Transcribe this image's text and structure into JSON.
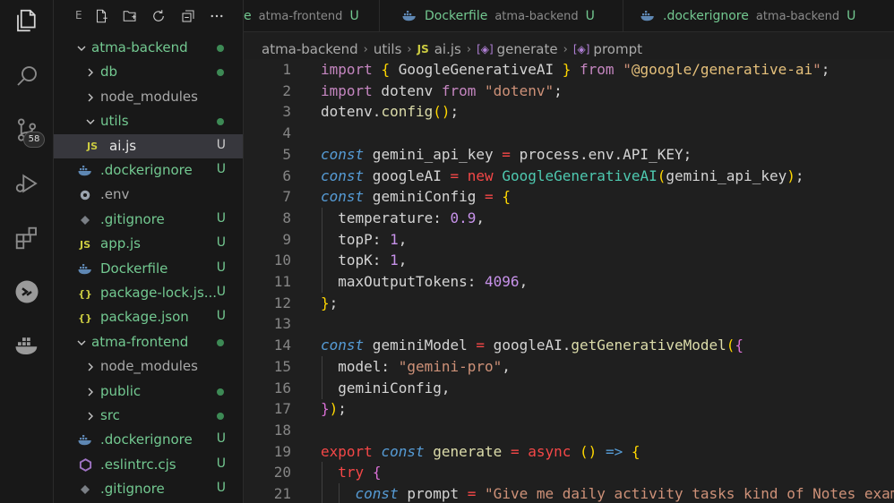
{
  "activity_bar": {
    "items": [
      {
        "name": "explorer-icon"
      },
      {
        "name": "search-icon"
      },
      {
        "name": "source-control-icon",
        "badge": "58"
      },
      {
        "name": "run-debug-icon"
      },
      {
        "name": "extensions-icon"
      },
      {
        "name": "remote-icon"
      },
      {
        "name": "docker-icon"
      }
    ]
  },
  "sidebar": {
    "toolbar_letter": "E",
    "tree": [
      {
        "label": "atma-backend",
        "type": "folder",
        "open": true,
        "level": 0,
        "status": "dot"
      },
      {
        "label": "db",
        "type": "folder",
        "open": false,
        "level": 1,
        "status": "dot"
      },
      {
        "label": "node_modules",
        "type": "folder",
        "open": false,
        "level": 1,
        "status": ""
      },
      {
        "label": "utils",
        "type": "folder",
        "open": true,
        "level": 1,
        "status": "dot"
      },
      {
        "label": "ai.js",
        "type": "js",
        "level": 2,
        "status": "U",
        "selected": true
      },
      {
        "label": ".dockerignore",
        "type": "docker",
        "level": 1,
        "status": "U"
      },
      {
        "label": ".env",
        "type": "gear",
        "level": 1,
        "status": ""
      },
      {
        "label": ".gitignore",
        "type": "git",
        "level": 1,
        "status": "U"
      },
      {
        "label": "app.js",
        "type": "js",
        "level": 1,
        "status": "U"
      },
      {
        "label": "Dockerfile",
        "type": "docker",
        "level": 1,
        "status": "U"
      },
      {
        "label": "package-lock.js...",
        "type": "json",
        "level": 1,
        "status": "U"
      },
      {
        "label": "package.json",
        "type": "json",
        "level": 1,
        "status": "U"
      },
      {
        "label": "atma-frontend",
        "type": "folder",
        "open": true,
        "level": 0,
        "status": "dot"
      },
      {
        "label": "node_modules",
        "type": "folder",
        "open": false,
        "level": 1,
        "status": ""
      },
      {
        "label": "public",
        "type": "folder",
        "open": false,
        "level": 1,
        "status": "dot"
      },
      {
        "label": "src",
        "type": "folder",
        "open": false,
        "level": 1,
        "status": "dot"
      },
      {
        "label": ".dockerignore",
        "type": "docker",
        "level": 1,
        "status": "U"
      },
      {
        "label": ".eslintrc.cjs",
        "type": "eslint",
        "level": 1,
        "status": "U"
      },
      {
        "label": ".gitignore",
        "type": "git",
        "level": 1,
        "status": "U"
      }
    ]
  },
  "tabs": [
    {
      "name": "e",
      "desc": "atma-frontend",
      "status": "U",
      "icon": "none"
    },
    {
      "name": "Dockerfile",
      "desc": "atma-backend",
      "status": "U",
      "icon": "docker"
    },
    {
      "name": ".dockerignore",
      "desc": "atma-backend",
      "status": "U",
      "icon": "docker"
    }
  ],
  "breadcrumb": {
    "items": [
      "atma-backend",
      "utils",
      "ai.js",
      "generate",
      "prompt"
    ]
  },
  "editor": {
    "lines": [
      {
        "n": "1",
        "tokens": [
          [
            "kw",
            "import"
          ],
          [
            "pl",
            " "
          ],
          [
            "br",
            "{"
          ],
          [
            "pl",
            " GoogleGenerativeAI "
          ],
          [
            "br",
            "}"
          ],
          [
            "pl",
            " "
          ],
          [
            "kw",
            "from"
          ],
          [
            "pl",
            " "
          ],
          [
            "st",
            "\""
          ],
          [
            "st2",
            "@google/generative-ai"
          ],
          [
            "st",
            "\""
          ],
          [
            "pl",
            ";"
          ]
        ]
      },
      {
        "n": "2",
        "tokens": [
          [
            "kw",
            "import"
          ],
          [
            "pl",
            " dotenv "
          ],
          [
            "kw",
            "from"
          ],
          [
            "pl",
            " "
          ],
          [
            "st",
            "\"dotenv\""
          ],
          [
            "pl",
            ";"
          ]
        ]
      },
      {
        "n": "3",
        "tokens": [
          [
            "pl",
            "dotenv."
          ],
          [
            "fn",
            "config"
          ],
          [
            "br",
            "()"
          ],
          [
            "pl",
            ";"
          ]
        ]
      },
      {
        "n": "4",
        "tokens": []
      },
      {
        "n": "5",
        "tokens": [
          [
            "cst",
            "const"
          ],
          [
            "pl",
            " gemini_api_key "
          ],
          [
            "op",
            "="
          ],
          [
            "pl",
            " process.env.API_KEY;"
          ]
        ]
      },
      {
        "n": "6",
        "tokens": [
          [
            "cst",
            "const"
          ],
          [
            "pl",
            " googleAI "
          ],
          [
            "op",
            "="
          ],
          [
            "pl",
            " "
          ],
          [
            "kw2",
            "new"
          ],
          [
            "pl",
            " "
          ],
          [
            "fn2",
            "GoogleGenerativeAI"
          ],
          [
            "br",
            "("
          ],
          [
            "pl",
            "gemini_api_key"
          ],
          [
            "br",
            ")"
          ],
          [
            "pl",
            ";"
          ]
        ]
      },
      {
        "n": "7",
        "tokens": [
          [
            "cst",
            "const"
          ],
          [
            "pl",
            " geminiConfig "
          ],
          [
            "op",
            "="
          ],
          [
            "pl",
            " "
          ],
          [
            "br",
            "{"
          ]
        ]
      },
      {
        "n": "8",
        "tokens": [
          [
            "pl",
            "  temperature: "
          ],
          [
            "nm2",
            "0.9"
          ],
          [
            "pl",
            ","
          ]
        ]
      },
      {
        "n": "9",
        "tokens": [
          [
            "pl",
            "  topP: "
          ],
          [
            "nm2",
            "1"
          ],
          [
            "pl",
            ","
          ]
        ]
      },
      {
        "n": "10",
        "tokens": [
          [
            "pl",
            "  topK: "
          ],
          [
            "nm2",
            "1"
          ],
          [
            "pl",
            ","
          ]
        ]
      },
      {
        "n": "11",
        "tokens": [
          [
            "pl",
            "  maxOutputTokens: "
          ],
          [
            "nm2",
            "4096"
          ],
          [
            "pl",
            ","
          ]
        ]
      },
      {
        "n": "12",
        "tokens": [
          [
            "br",
            "}"
          ],
          [
            "pl",
            ";"
          ]
        ]
      },
      {
        "n": "13",
        "tokens": []
      },
      {
        "n": "14",
        "tokens": [
          [
            "cst",
            "const"
          ],
          [
            "pl",
            " geminiModel "
          ],
          [
            "op",
            "="
          ],
          [
            "pl",
            " googleAI."
          ],
          [
            "fn",
            "getGenerativeModel"
          ],
          [
            "br",
            "("
          ],
          [
            "br2",
            "{"
          ]
        ]
      },
      {
        "n": "15",
        "tokens": [
          [
            "pl",
            "  model: "
          ],
          [
            "st",
            "\"gemini-pro\""
          ],
          [
            "pl",
            ","
          ]
        ]
      },
      {
        "n": "16",
        "tokens": [
          [
            "pl",
            "  geminiConfig,"
          ]
        ]
      },
      {
        "n": "17",
        "tokens": [
          [
            "br2",
            "}"
          ],
          [
            "br",
            ")"
          ],
          [
            "pl",
            ";"
          ]
        ]
      },
      {
        "n": "18",
        "tokens": []
      },
      {
        "n": "19",
        "tokens": [
          [
            "kw2",
            "export"
          ],
          [
            "pl",
            " "
          ],
          [
            "cst",
            "const"
          ],
          [
            "pl",
            " "
          ],
          [
            "fn",
            "generate"
          ],
          [
            "pl",
            " "
          ],
          [
            "op",
            "="
          ],
          [
            "pl",
            " "
          ],
          [
            "kw2",
            "async"
          ],
          [
            "pl",
            " "
          ],
          [
            "br",
            "()"
          ],
          [
            "pl",
            " "
          ],
          [
            "arr",
            "=>"
          ],
          [
            "pl",
            " "
          ],
          [
            "br",
            "{"
          ]
        ]
      },
      {
        "n": "20",
        "tokens": [
          [
            "pl",
            "  "
          ],
          [
            "kw2",
            "try"
          ],
          [
            "pl",
            " "
          ],
          [
            "br2",
            "{"
          ]
        ]
      },
      {
        "n": "21",
        "tokens": [
          [
            "pl",
            "    "
          ],
          [
            "cst",
            "const"
          ],
          [
            "pl",
            " prompt "
          ],
          [
            "op",
            "="
          ],
          [
            "pl",
            " "
          ],
          [
            "st",
            "\"Give me daily activity tasks kind of Notes exam"
          ]
        ]
      }
    ]
  },
  "colors": {
    "accent_green": "#73c991",
    "folder_dot": "#3d8a55",
    "js_yellow": "#cbcb41",
    "docker_blue": "#5e87b3"
  }
}
